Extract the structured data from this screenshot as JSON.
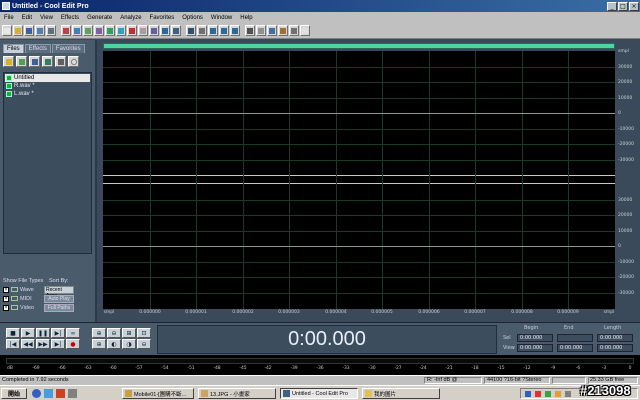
{
  "window": {
    "title": "Untitled - Cool Edit Pro",
    "min_label": "_",
    "max_label": "□",
    "close_label": "×"
  },
  "menu": [
    "File",
    "Edit",
    "View",
    "Effects",
    "Generate",
    "Analyze",
    "Favorites",
    "Options",
    "Window",
    "Help"
  ],
  "toolbar": {
    "icons": [
      "new-icon",
      "open-icon",
      "save-icon",
      "multitrack-icon",
      "undo-icon",
      "cut-icon",
      "copy-icon",
      "paste-icon",
      "mix-paste-icon",
      "play-icon",
      "loop-icon",
      "record-icon",
      "cd-icon",
      "cue-list-icon",
      "zoom-icon",
      "spectral-icon",
      "waveform-icon",
      "mono-icon",
      "stereo-icon",
      "left-icon",
      "right-icon",
      "grid-icon",
      "snap-icon",
      "info-icon",
      "timer-icon",
      "settings-icon",
      "help-icon"
    ],
    "colors": {
      "face": "#d6d6d6",
      "accent": "#2a6a9a"
    }
  },
  "left_panel": {
    "tabs": [
      "Files",
      "Effects",
      "Favorites"
    ],
    "active_tab": "Files",
    "files": [
      "Untitled",
      "R.wav *",
      "L.wav *"
    ],
    "selected_file": "Untitled",
    "show_file_types_label": "Show File Types",
    "sort_by_label": "Sort By:",
    "file_types": [
      {
        "label": "Wave",
        "checked": true
      },
      {
        "label": "MIDI",
        "checked": true
      },
      {
        "label": "Video",
        "checked": true
      }
    ],
    "sort_value": "Recent Acce",
    "auto_play_label": "Auto Play",
    "full_paths_label": "Full Paths"
  },
  "waveform": {
    "y_ticks_top": [
      "smpl",
      "30000",
      "20000",
      "10000",
      "0",
      "-10000",
      "-20000",
      "-30000"
    ],
    "y_ticks_bottom": [
      "30000",
      "20000",
      "10000",
      "0",
      "-10000",
      "-20000",
      "-30000"
    ],
    "x_ticks": [
      "smpl",
      "0.000000",
      "0.000001",
      "0.000002",
      "0.000003",
      "0.000004",
      "0.000005",
      "0.000006",
      "0.000007",
      "0.000008",
      "0.000009",
      "smpl"
    ],
    "overview_color": "#48d8a0",
    "background": "#000000",
    "grid_color": "#1c3a28"
  },
  "transport": {
    "time": "0:00.000",
    "buttons": [
      "stop",
      "play",
      "pause",
      "play-to-end",
      "loop",
      "go-start",
      "rewind",
      "fast-forward",
      "go-end",
      "record"
    ],
    "zoom_buttons": [
      "zoom-in-h",
      "zoom-out-h",
      "zoom-full",
      "zoom-sel",
      "zoom-in-v",
      "zoom-left",
      "zoom-right",
      "zoom-out-v"
    ],
    "headers": [
      "Begin",
      "End",
      "Length"
    ],
    "rows": [
      {
        "label": "Sel",
        "begin": "0:00.000",
        "end": "",
        "length": "0:00.000"
      },
      {
        "label": "View",
        "begin": "0:00.000",
        "end": "0:00.000",
        "length": "0:00.000"
      }
    ]
  },
  "meter": {
    "ticks": [
      "dB",
      "-69",
      "-66",
      "-63",
      "-60",
      "-57",
      "-54",
      "-51",
      "-48",
      "-45",
      "-42",
      "-39",
      "-36",
      "-33",
      "-30",
      "-27",
      "-24",
      "-21",
      "-18",
      "-15",
      "-12",
      "-9",
      "-6",
      "-3",
      "0"
    ]
  },
  "status": {
    "message": "Completed in 7.92 seconds",
    "level": "R: -Inf dB @",
    "format": "44100 ?16-bit ?Stereo",
    "size": "",
    "free": "25.33 GB free"
  },
  "taskbar": {
    "start": "開始",
    "tasks": [
      {
        "label": "Mobile01-[團購不斷...",
        "active": false
      },
      {
        "label": "13.JPG - 小畫家",
        "active": false
      },
      {
        "label": "Untitled - Cool Edit Pro",
        "active": true
      },
      {
        "label": "我的圖片",
        "active": false
      }
    ],
    "clock": ""
  },
  "watermark": "#213098"
}
